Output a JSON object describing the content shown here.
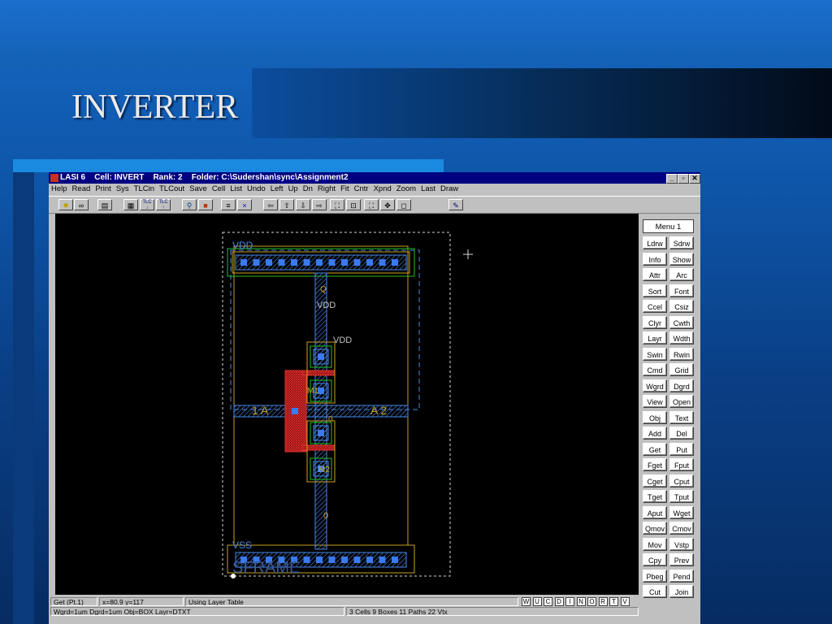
{
  "slide": {
    "title": "INVERTER"
  },
  "window": {
    "title": "LASI 6    Cell: INVERT    Rank: 2    Folder: C:\\Sudershan\\sync\\Assignment2",
    "controls": [
      "_",
      "▫",
      "✕"
    ]
  },
  "menu": [
    "Help",
    "Read",
    "Print",
    "Sys",
    "TLCin",
    "TLCout",
    "Save",
    "Cell",
    "List",
    "Undo",
    "Left",
    "Up",
    "Dn",
    "Right",
    "Fit",
    "Cntr",
    "Xpnd",
    "Zoom",
    "Last",
    "Draw"
  ],
  "toolbar": {
    "tlc_in_label": "TLC",
    "tlc_out_label": "TLC"
  },
  "layout": {
    "labels": {
      "vdd_rail": "VDD",
      "vdd_1": "VDD",
      "vdd_2": "VDD",
      "vss": "VSS",
      "frame": "SFRAME",
      "in_a": "1 A",
      "out_a": "A 2",
      "m1": "M1",
      "m2": "M2",
      "node_0_top": "0",
      "node_0_bot": "0",
      "node_q": "Q"
    }
  },
  "sidemenu": {
    "title": "Menu 1",
    "buttons": [
      [
        "Ldrw",
        "Sdrw"
      ],
      [
        "Info",
        "Show"
      ],
      [
        "Attr",
        "Arc"
      ],
      [
        "Sort",
        "Font"
      ],
      [
        "Ccel",
        "Csiz"
      ],
      [
        "Clyr",
        "Cwth"
      ],
      [
        "Layr",
        "Wdth"
      ],
      [
        "Swin",
        "Rwin"
      ],
      [
        "Cmd",
        "Grid"
      ],
      [
        "Wgrd",
        "Dgrd"
      ],
      [
        "View",
        "Open"
      ],
      [
        "Obj",
        "Text"
      ],
      [
        "Add",
        "Del"
      ],
      [
        "Get",
        "Put"
      ],
      [
        "Fget",
        "Fput"
      ],
      [
        "Cget",
        "Cput"
      ],
      [
        "Tget",
        "Tput"
      ],
      [
        "Aput",
        "Wget"
      ],
      [
        "Qmov",
        "Cmov"
      ],
      [
        "Mov",
        "Vstp"
      ],
      [
        "Cpy",
        "Prev"
      ],
      [
        "Pbeg",
        "Pend"
      ],
      [
        "Cut",
        "Join"
      ]
    ]
  },
  "status": {
    "mode": "Get (Pt.1)",
    "coords": "x=80.9  y=117",
    "message": "Using Layer Table",
    "flags": [
      "W",
      "U",
      "C",
      "D",
      "I",
      "N",
      "O",
      "R",
      "T",
      "V"
    ],
    "grid": "Wgrd=1um  Dgrd=1um  Obj=BOX  Layr=DTXT",
    "counts": "3 Cells  9 Boxes  11 Paths  22 Vtx"
  },
  "colors": {
    "poly": "#c02020",
    "metal": "#4a8ae8",
    "active": "#20c020",
    "nwell": "#c8a020",
    "window_title": "#000080"
  }
}
